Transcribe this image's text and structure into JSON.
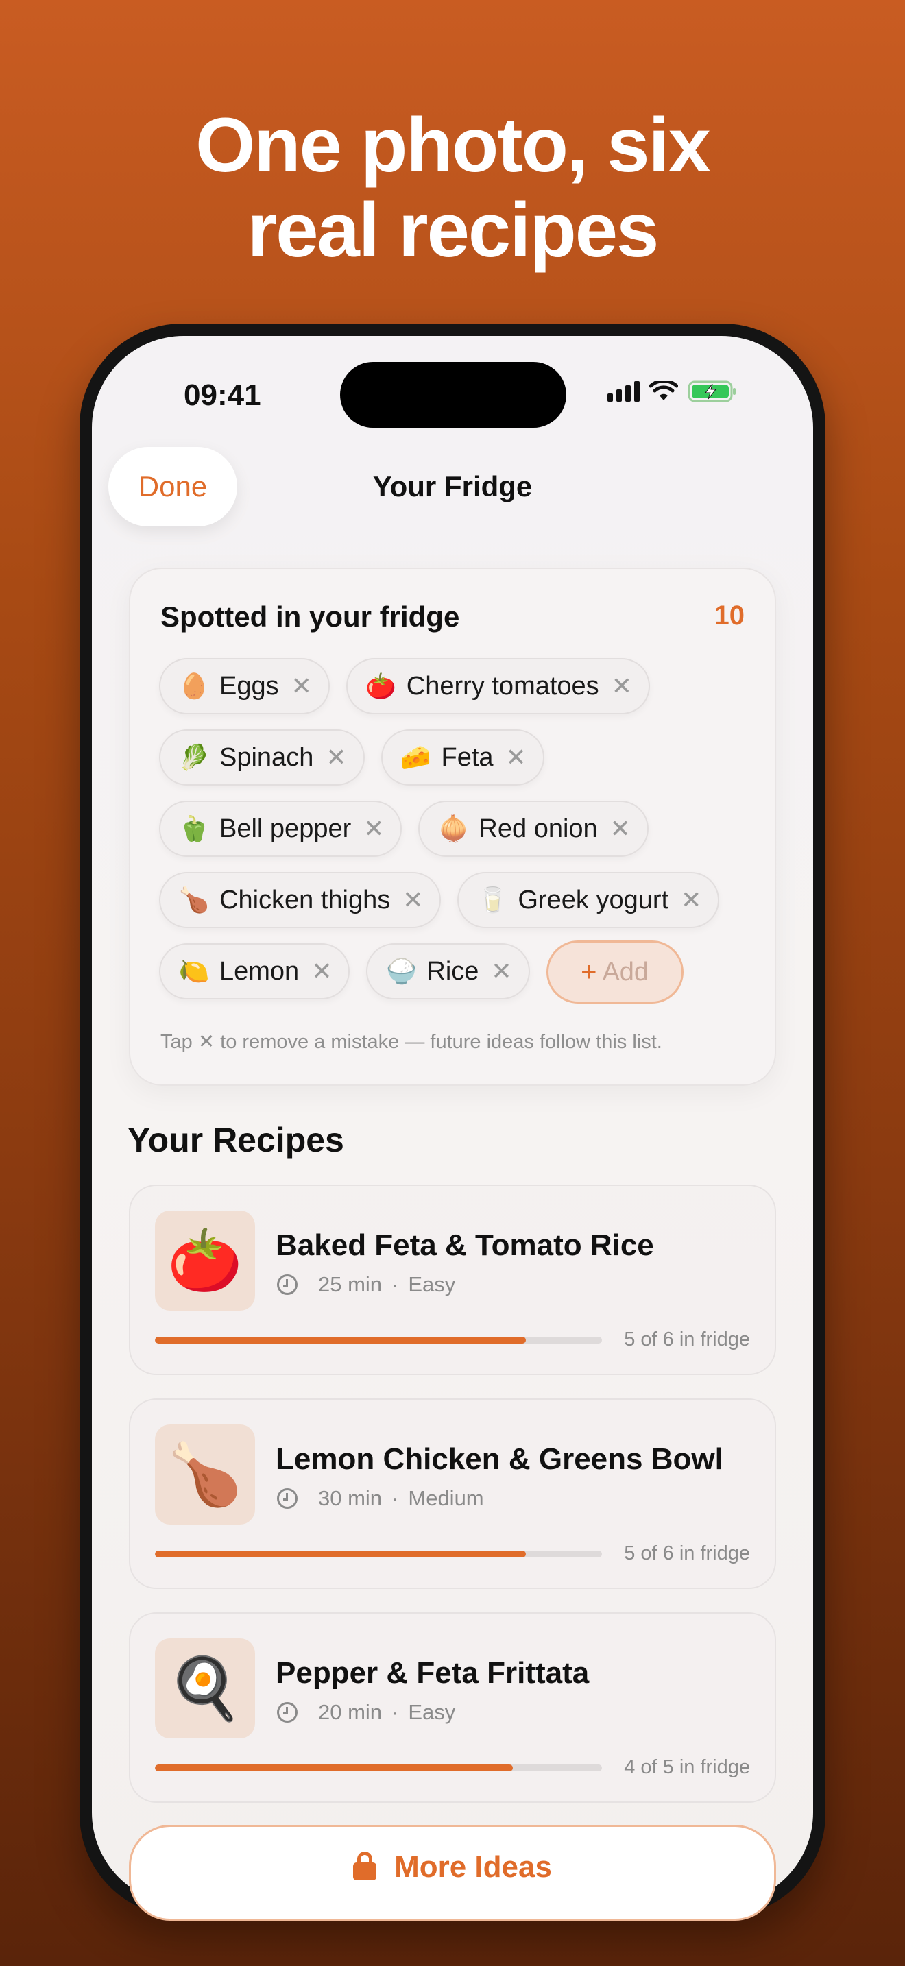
{
  "headline": {
    "line1": "One photo, six",
    "line2": "real recipes"
  },
  "status_bar": {
    "time": "09:41"
  },
  "nav": {
    "done_label": "Done",
    "title": "Your Fridge"
  },
  "fridge": {
    "title": "Spotted in your fridge",
    "count": "10",
    "rows": [
      [
        {
          "emoji": "🥚",
          "label": "Eggs"
        },
        {
          "emoji": "🍅",
          "label": "Cherry tomatoes"
        }
      ],
      [
        {
          "emoji": "🥬",
          "label": "Spinach"
        },
        {
          "emoji": "🧀",
          "label": "Feta"
        }
      ],
      [
        {
          "emoji": "🫑",
          "label": "Bell pepper"
        },
        {
          "emoji": "🧅",
          "label": "Red onion"
        }
      ],
      [
        {
          "emoji": "🍗",
          "label": "Chicken thighs"
        },
        {
          "emoji": "🥛",
          "label": "Greek yogurt"
        }
      ],
      [
        {
          "emoji": "🍋",
          "label": "Lemon"
        },
        {
          "emoji": "🍚",
          "label": "Rice"
        }
      ]
    ],
    "remove_glyph": "✕",
    "add_plus": "+",
    "add_label": "Add",
    "hint": "Tap ✕ to remove a mistake — future ideas follow this list."
  },
  "recipes": {
    "title": "Your Recipes",
    "items": [
      {
        "emoji": "🍅",
        "name": "Baked Feta & Tomato Rice",
        "time": "25 min",
        "difficulty": "Easy",
        "separator": "·",
        "fridge_label": "5 of 6 in fridge",
        "progress": 0.83
      },
      {
        "emoji": "🍗",
        "name": "Lemon Chicken & Greens Bowl",
        "time": "30 min",
        "difficulty": "Medium",
        "separator": "·",
        "fridge_label": "5 of 6 in fridge",
        "progress": 0.83
      },
      {
        "emoji": "🍳",
        "name": "Pepper & Feta Frittata",
        "time": "20 min",
        "difficulty": "Easy",
        "separator": "·",
        "fridge_label": "4 of 5 in fridge",
        "progress": 0.8
      }
    ]
  },
  "more_button": {
    "label": "More Ideas",
    "icon": "lock-icon"
  },
  "colors": {
    "accent": "#e06c2a",
    "background_top": "#c95c22",
    "background_bottom": "#5a240a"
  }
}
